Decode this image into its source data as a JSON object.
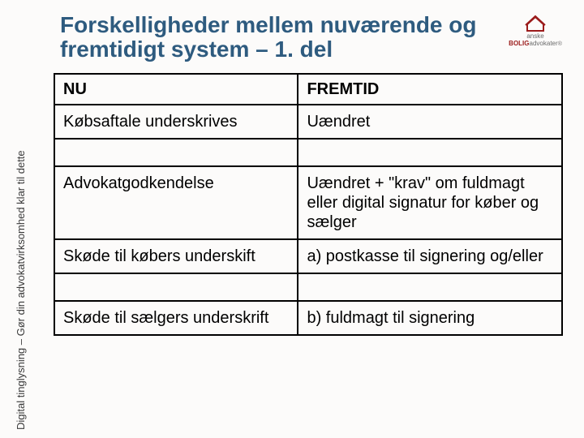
{
  "title": "Forskelligheder mellem nuværende og fremtidigt system – 1. del",
  "sidebar": "Digital tinglysning – Gør din advokatvirksomhed klar til dette",
  "logo": {
    "line1_plain": "anske",
    "line2_red": "BOLIG",
    "line2_plain": "advokater",
    "sub": "®"
  },
  "table": {
    "headers": {
      "left": "NU",
      "right": "FREMTID"
    },
    "rows": [
      {
        "left": "Købsaftale underskrives",
        "right": "Uændret"
      },
      {
        "left": "Advokatgodkendelse",
        "right": "Uændret + \"krav\" om fuldmagt eller digital signatur for køber og sælger"
      },
      {
        "left": "Skøde til købers underskift",
        "right": "a) postkasse til signering og/eller"
      },
      {
        "left": "Skøde til sælgers underskrift",
        "right": "b) fuldmagt til signering"
      }
    ]
  }
}
